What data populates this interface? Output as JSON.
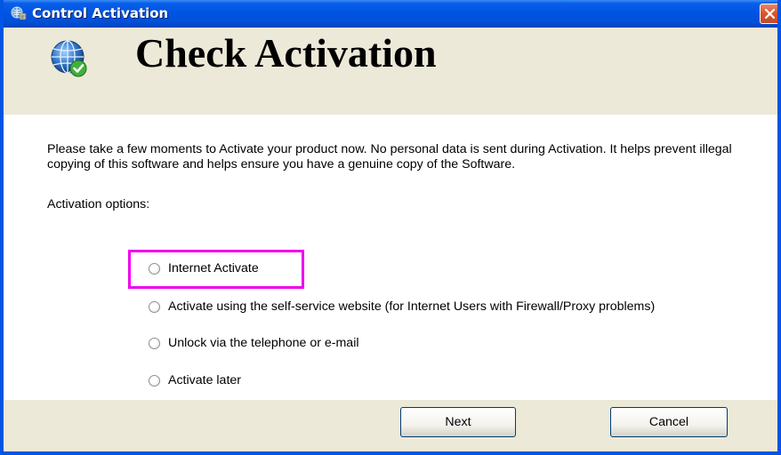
{
  "window": {
    "title": "Control Activation"
  },
  "header": {
    "title": "Check Activation"
  },
  "main": {
    "description": "Please take a few moments to Activate your product now.  No personal data is sent during Activation.  It helps prevent illegal copying of this software and helps ensure you have a genuine copy of the Software.",
    "options_label": "Activation options:",
    "options": [
      {
        "label": "Internet Activate",
        "selected": false,
        "highlighted": true
      },
      {
        "label": "Activate using the self-service website (for Internet Users with Firewall/Proxy problems)",
        "selected": false
      },
      {
        "label": "Unlock via the telephone or e-mail",
        "selected": false
      },
      {
        "label": "Activate later",
        "selected": false
      }
    ],
    "highlight_color": "#ee00ee"
  },
  "footer": {
    "next_label": "Next",
    "cancel_label": "Cancel"
  },
  "icons": {
    "title_icon": "activation-globe-icon",
    "header_icon": "globe-checkmark-icon",
    "close_icon": "close-icon",
    "radio": "radio-button"
  },
  "colors": {
    "titlebar": "#0054e3",
    "window_bg": "#ece9d8",
    "content_bg": "#ffffff",
    "close_button": "#d8572f",
    "button_border": "#003c74"
  }
}
